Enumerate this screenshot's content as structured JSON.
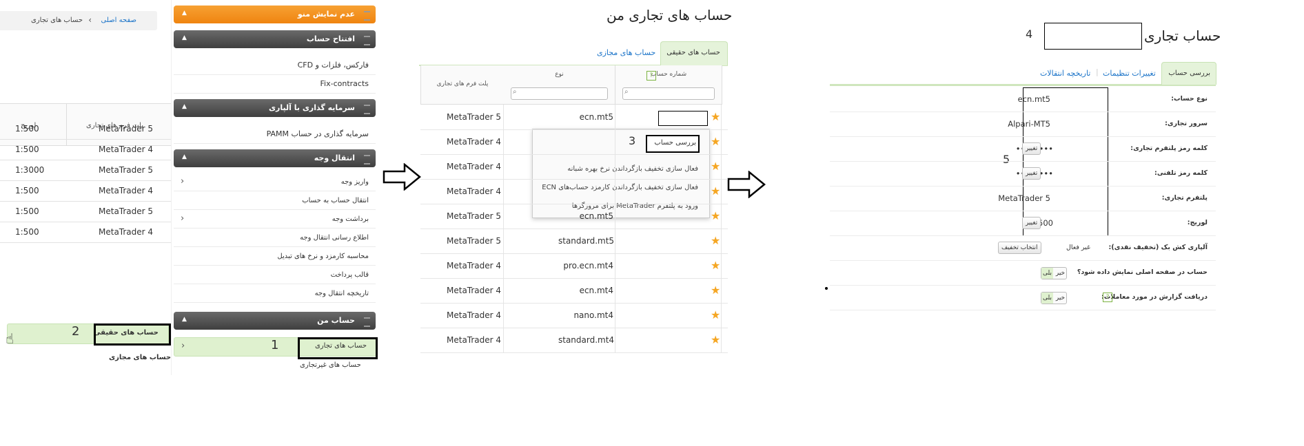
{
  "panel1": {
    "breadcrumb": {
      "home": "صفحه اصلی",
      "separator": "›",
      "current": "حساب های تجاری"
    },
    "table_headers": {
      "platform": "پلت فرم های تجاری",
      "leverage": "لوریج"
    },
    "rows": [
      {
        "platform": "MetaTrader 5",
        "leverage": "1:500"
      },
      {
        "platform": "MetaTrader 4",
        "leverage": "1:500"
      },
      {
        "platform": "MetaTrader 5",
        "leverage": "1:3000"
      },
      {
        "platform": "MetaTrader 4",
        "leverage": "1:500"
      },
      {
        "platform": "MetaTrader 5",
        "leverage": "1:500"
      },
      {
        "platform": "MetaTrader 4",
        "leverage": "1:500"
      }
    ],
    "submenu": {
      "real": "حساب های حقیقی",
      "virtual": "حساب های مجازی",
      "step_number": "2"
    },
    "menu": {
      "hide_menu": "عدم نمایش منو",
      "open_account": {
        "title": "افتتاح حساب",
        "items": [
          "فارکس، فلزات و CFD",
          "Fix-contracts"
        ]
      },
      "invest": {
        "title": "سرمایه گذاری با آلپاری",
        "items": [
          "سرمایه گذاری در حساب PAMM"
        ]
      },
      "transfer": {
        "title": "انتقال وجه",
        "items": [
          "واریز وجه",
          "انتقال حساب به حساب",
          "برداشت وجه",
          "اطلاع رسانی انتقال وجه",
          "محاسبه کارمزد و نرخ های تبدیل",
          "قالب پرداخت",
          "تاریخچه انتقال وجه"
        ]
      },
      "my_account": {
        "title": "حساب من",
        "items": [
          "حساب های تجاری",
          "حساب های غیرتجاری"
        ],
        "step_number": "1"
      }
    }
  },
  "panel2": {
    "title": "حساب های تجاری من",
    "tabs": {
      "real": "حساب های حقیقی",
      "virtual": "حساب های مجازی"
    },
    "headers": {
      "account": "شماره حساب",
      "type": "نوع",
      "platform": "پلت فرم های تجاری",
      "help": "?"
    },
    "rows": [
      {
        "type": "ecn.mt5",
        "platform": "MetaTrader 5"
      },
      {
        "type": "",
        "platform": "MetaTrader 4"
      },
      {
        "type": "",
        "platform": "MetaTrader 4"
      },
      {
        "type": "",
        "platform": "MetaTrader 4"
      },
      {
        "type": "ecn.mt5",
        "platform": "MetaTrader 5"
      },
      {
        "type": "standard.mt5",
        "platform": "MetaTrader 5"
      },
      {
        "type": "pro.ecn.mt4",
        "platform": "MetaTrader 4"
      },
      {
        "type": "ecn.mt4",
        "platform": "MetaTrader 4"
      },
      {
        "type": "nano.mt4",
        "platform": "MetaTrader 4"
      },
      {
        "type": "standard.mt4",
        "platform": "MetaTrader 4"
      }
    ],
    "context_menu": {
      "items": [
        "بررسی حساب",
        "فعال سازی تخفیف بازگرداندن نرخ بهره شبانه",
        "فعال سازی تخفیف بازگرداندن کارمزد حساب‌های ECN",
        "ورود به پلتفرم MetaTrader برای مرورگرها"
      ],
      "step_number": "3"
    }
  },
  "panel3": {
    "title": "حساب تجاری",
    "step_title_number": "4",
    "step_values_number": "5",
    "tabs": [
      "بررسی حساب",
      "تغییرات تنظیمات",
      "تاریخچه انتقالات"
    ],
    "rows": [
      {
        "label": "نوع حساب:",
        "value": "ecn.mt5"
      },
      {
        "label": "سرور تجاری:",
        "value": "Alpari-MT5"
      },
      {
        "label": "کلمه رمز پلتفرم تجاری:",
        "value": "••••••••",
        "button": "تغییر"
      },
      {
        "label": "کلمه رمز تلفنی:",
        "value": "••••••••",
        "button": "تغییر"
      },
      {
        "label": "پلتفرم تجاری:",
        "value": "MetaTrader 5"
      },
      {
        "label": "لوریج:",
        "value": "1:500",
        "button": "تغییر"
      },
      {
        "label": "آلپاری کش بک (تخفیف نقدی):",
        "value": "غیر فعال",
        "button": "انتخاب تخفیف"
      },
      {
        "label": "حساب در صفحه اصلی نمایش داده شود؟",
        "yes": "بلی",
        "no": "خیر"
      },
      {
        "label": "دریافت گزارش در مورد معاملات:",
        "yes": "بلی",
        "no": "خیر",
        "help": "?"
      }
    ]
  },
  "colors": {
    "accent_green": "#dff1cf",
    "menu_orange": "#ef8410",
    "menu_gray": "#4a4a4a",
    "star": "#f5a623",
    "link": "#1a73c8"
  },
  "icons": [
    "search-icon",
    "star-icon",
    "chevron-icon",
    "arrow-right-icon",
    "hand-cursor-icon",
    "help-icon"
  ]
}
